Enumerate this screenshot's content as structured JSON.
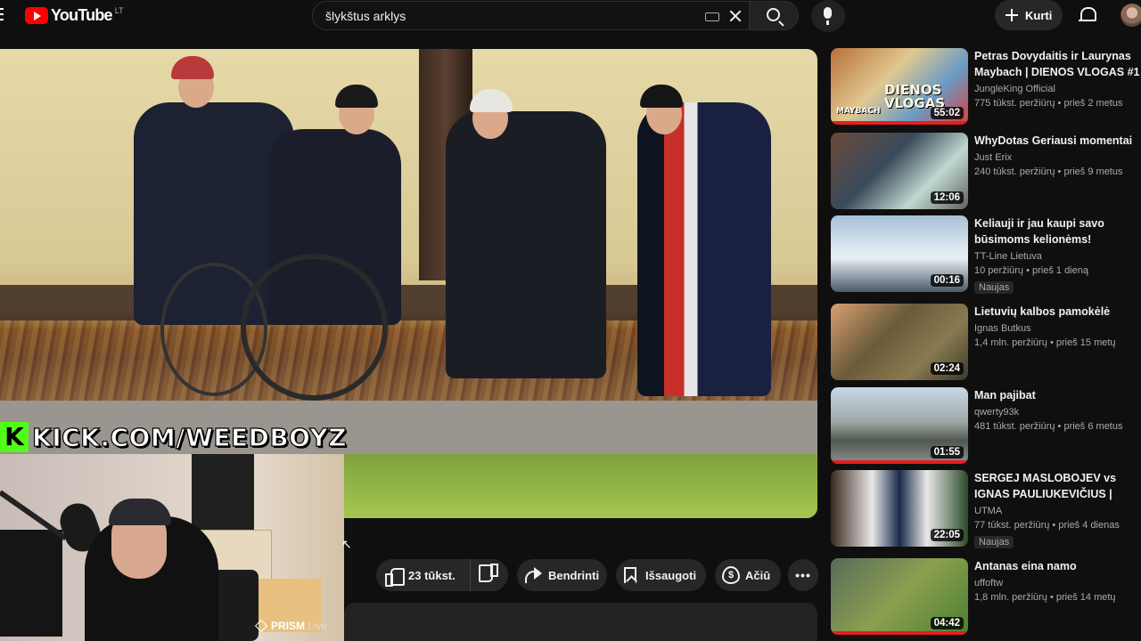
{
  "header": {
    "logo_text": "YouTube",
    "country_code": "LT",
    "search_value": "šlykštus arklys",
    "create_label": "Kurti",
    "brand_color": "#ff0000"
  },
  "player": {
    "overlay_kick_text": "KICK.COM/WEEDBOYZ",
    "kick_logo": "K",
    "kick_color": "#53fc18",
    "prism_brand": "PRISM",
    "prism_live": "Live"
  },
  "actions": {
    "like_count": "23 tūkst.",
    "share_label": "Bendrinti",
    "save_label": "Išsaugoti",
    "thanks_label": "Ačiū",
    "more_label": "•••"
  },
  "recommendations": [
    {
      "title": "Petras Dovydaitis ir Laurynas Maybach | DIENOS VLOGAS #1",
      "channel": "JungleKing Official",
      "meta": "775 tūkst. peržiūrų • prieš 2 metus",
      "duration": "55:02",
      "thumb_text": "DIENOS VLOGAS",
      "thumb_sub": "MAYBACH",
      "badge": ""
    },
    {
      "title": "WhyDotas Geriausi momentai",
      "channel": "Just Erix",
      "meta": "240 tūkst. peržiūrų • prieš 9 metus",
      "duration": "12:06",
      "badge": ""
    },
    {
      "title": "Keliauji ir jau kaupi savo būsimoms kelionėms!",
      "channel": "TT-Line Lietuva",
      "meta": "10 peržiūrų • prieš 1 dieną",
      "duration": "00:16",
      "badge": "Naujas"
    },
    {
      "title": "Lietuvių kalbos pamokėlė",
      "channel": "Ignas Butkus",
      "meta": "1,4 mln. peržiūrų • prieš 15 metų",
      "duration": "02:24",
      "badge": ""
    },
    {
      "title": "Man pajibat",
      "channel": "qwerty93k",
      "meta": "481 tūkst. peržiūrų • prieš 6 metus",
      "duration": "01:55",
      "badge": ""
    },
    {
      "title": "SERGEJ MASLOBOJEV vs IGNAS PAULIUKEVIČIUS | FUL...",
      "channel": "UTMA",
      "meta": "77 tūkst. peržiūrų • prieš 4 dienas",
      "duration": "22:05",
      "badge": "Naujas"
    },
    {
      "title": "Antanas eina namo",
      "channel": "uffoftw",
      "meta": "1,8 mln. peržiūrų • prieš 14 metų",
      "duration": "04:42",
      "badge": ""
    }
  ]
}
